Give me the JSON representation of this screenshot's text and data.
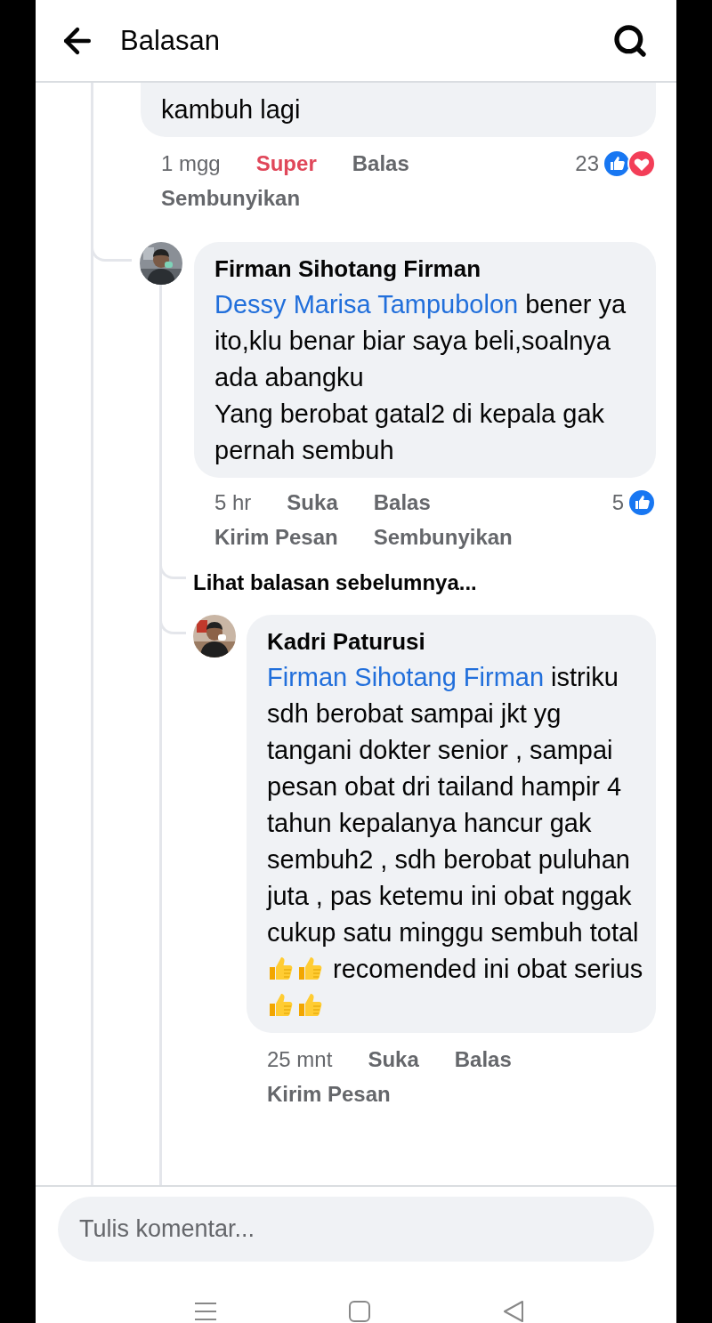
{
  "header": {
    "title": "Balasan"
  },
  "parent_comment": {
    "body": [
      {
        "kind": "text",
        "text": "kambuh lagi"
      }
    ],
    "time": "1 mgg",
    "actions": [
      {
        "label": "Super",
        "selected": true
      },
      {
        "label": "Balas",
        "selected": false
      },
      {
        "label": "Sembunyikan",
        "selected": false
      }
    ],
    "reaction_count": "23",
    "reactions": [
      {
        "kind": "like"
      },
      {
        "kind": "love"
      }
    ]
  },
  "reply": {
    "author": "Firman Sihotang Firman",
    "body": [
      {
        "kind": "mention",
        "text": "Dessy Marisa Tampubolon"
      },
      {
        "kind": "text",
        "text": " bener ya ito,klu benar biar saya beli,soalnya ada abangku\nYang berobat gatal2 di kepala gak pernah sembuh"
      }
    ],
    "time": "5 hr",
    "actions": [
      {
        "label": "Suka",
        "selected": false
      },
      {
        "label": "Balas",
        "selected": false
      },
      {
        "label": "Kirim Pesan",
        "selected": false
      },
      {
        "label": "Sembunyikan",
        "selected": false
      }
    ],
    "reaction_count": "5",
    "reactions": [
      {
        "kind": "like"
      }
    ]
  },
  "previous_replies_link": "Lihat balasan sebelumnya...",
  "nested_reply": {
    "author": "Kadri Paturusi",
    "body": [
      {
        "kind": "mention",
        "text": "Firman Sihotang Firman"
      },
      {
        "kind": "text",
        "text": " istriku sdh berobat sampai jkt yg tangani dokter senior , sampai pesan obat dri tailand hampir 4 tahun kepalanya hancur gak sembuh2 , sdh berobat puluhan juta , pas ketemu ini obat nggak cukup satu minggu sembuh total "
      },
      {
        "kind": "emoji"
      },
      {
        "kind": "emoji"
      },
      {
        "kind": "text",
        "text": " recomended ini obat serius "
      },
      {
        "kind": "emoji"
      },
      {
        "kind": "emoji"
      }
    ],
    "time": "25 mnt",
    "actions": [
      {
        "label": "Suka",
        "selected": false
      },
      {
        "label": "Balas",
        "selected": false
      },
      {
        "label": "Kirim Pesan",
        "selected": false
      }
    ]
  },
  "composer": {
    "placeholder": "Tulis komentar..."
  }
}
